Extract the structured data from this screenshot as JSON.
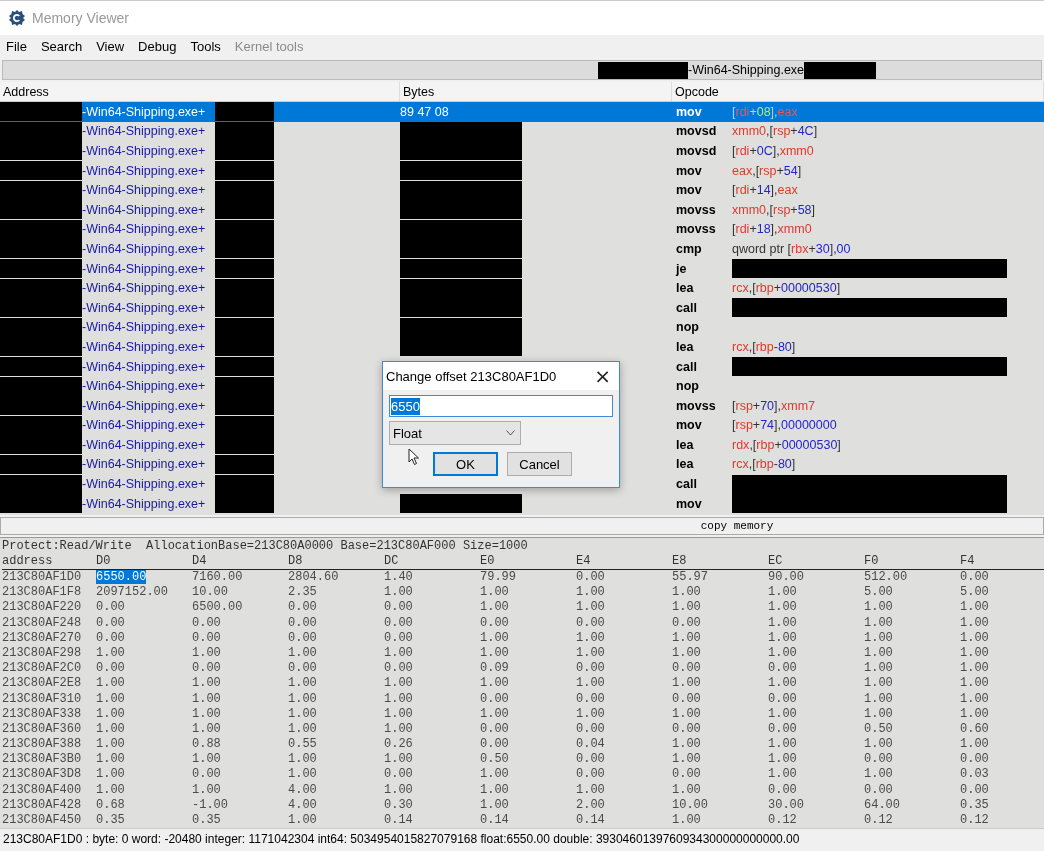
{
  "window": {
    "title": "Memory Viewer"
  },
  "menu": [
    {
      "label": "File",
      "disabled": false
    },
    {
      "label": "Search",
      "disabled": false
    },
    {
      "label": "View",
      "disabled": false
    },
    {
      "label": "Debug",
      "disabled": false
    },
    {
      "label": "Tools",
      "disabled": false
    },
    {
      "label": "Kernel tools",
      "disabled": true
    }
  ],
  "address_bar": {
    "text": "-Win64-Shipping.exe"
  },
  "disassembly": {
    "columns": [
      "Address",
      "Bytes",
      "Opcode"
    ],
    "rows": [
      {
        "module": "-Win64-Shipping.exe+",
        "selected": true,
        "bytes": "89 47 08",
        "bytes_redacted": false,
        "mnemonic": "mov",
        "operand_redacted": false,
        "operands": [
          {
            "kind": "sym",
            "text": "["
          },
          {
            "kind": "reg",
            "text": "rdi"
          },
          {
            "kind": "sym",
            "text": "+"
          },
          {
            "kind": "num",
            "text": "08"
          },
          {
            "kind": "sym",
            "text": "],"
          },
          {
            "kind": "reg",
            "text": "eax"
          }
        ]
      },
      {
        "module": "-Win64-Shipping.exe+",
        "selected": false,
        "bytes_redacted": true,
        "mnemonic": "movsd",
        "operand_redacted": false,
        "operands": [
          {
            "kind": "reg",
            "text": "xmm0"
          },
          {
            "kind": "sym",
            "text": ",["
          },
          {
            "kind": "reg",
            "text": "rsp"
          },
          {
            "kind": "sym",
            "text": "+"
          },
          {
            "kind": "num",
            "text": "4C"
          },
          {
            "kind": "sym",
            "text": "]"
          }
        ]
      },
      {
        "module": "-Win64-Shipping.exe+",
        "selected": false,
        "bytes_redacted": true,
        "mnemonic": "movsd",
        "operand_redacted": false,
        "operands": [
          {
            "kind": "sym",
            "text": "["
          },
          {
            "kind": "reg",
            "text": "rdi"
          },
          {
            "kind": "sym",
            "text": "+"
          },
          {
            "kind": "num",
            "text": "0C"
          },
          {
            "kind": "sym",
            "text": "],"
          },
          {
            "kind": "reg",
            "text": "xmm0"
          }
        ]
      },
      {
        "module": "-Win64-Shipping.exe+",
        "selected": false,
        "bytes_redacted": true,
        "mnemonic": "mov",
        "operand_redacted": false,
        "operands": [
          {
            "kind": "reg",
            "text": "eax"
          },
          {
            "kind": "sym",
            "text": ",["
          },
          {
            "kind": "reg",
            "text": "rsp"
          },
          {
            "kind": "sym",
            "text": "+"
          },
          {
            "kind": "num",
            "text": "54"
          },
          {
            "kind": "sym",
            "text": "]"
          }
        ]
      },
      {
        "module": "-Win64-Shipping.exe+",
        "selected": false,
        "bytes_redacted": true,
        "mnemonic": "mov",
        "operand_redacted": false,
        "operands": [
          {
            "kind": "sym",
            "text": "["
          },
          {
            "kind": "reg",
            "text": "rdi"
          },
          {
            "kind": "sym",
            "text": "+"
          },
          {
            "kind": "num",
            "text": "14"
          },
          {
            "kind": "sym",
            "text": "],"
          },
          {
            "kind": "reg",
            "text": "eax"
          }
        ]
      },
      {
        "module": "-Win64-Shipping.exe+",
        "selected": false,
        "bytes_redacted": true,
        "mnemonic": "movss",
        "operand_redacted": false,
        "operands": [
          {
            "kind": "reg",
            "text": "xmm0"
          },
          {
            "kind": "sym",
            "text": ",["
          },
          {
            "kind": "reg",
            "text": "rsp"
          },
          {
            "kind": "sym",
            "text": "+"
          },
          {
            "kind": "num",
            "text": "58"
          },
          {
            "kind": "sym",
            "text": "]"
          }
        ]
      },
      {
        "module": "-Win64-Shipping.exe+",
        "selected": false,
        "bytes_redacted": true,
        "mnemonic": "movss",
        "operand_redacted": false,
        "operands": [
          {
            "kind": "sym",
            "text": "["
          },
          {
            "kind": "reg",
            "text": "rdi"
          },
          {
            "kind": "sym",
            "text": "+"
          },
          {
            "kind": "num",
            "text": "18"
          },
          {
            "kind": "sym",
            "text": "],"
          },
          {
            "kind": "reg",
            "text": "xmm0"
          }
        ]
      },
      {
        "module": "-Win64-Shipping.exe+",
        "selected": false,
        "bytes_redacted": true,
        "mnemonic": "cmp",
        "operand_redacted": false,
        "operands": [
          {
            "kind": "sym",
            "text": "qword ptr ["
          },
          {
            "kind": "reg",
            "text": "rbx"
          },
          {
            "kind": "sym",
            "text": "+"
          },
          {
            "kind": "num",
            "text": "30"
          },
          {
            "kind": "sym",
            "text": "],"
          },
          {
            "kind": "num",
            "text": "00"
          }
        ]
      },
      {
        "module": "-Win64-Shipping.exe+",
        "selected": false,
        "bytes_redacted": true,
        "mnemonic": "je",
        "operand_redacted": true
      },
      {
        "module": "-Win64-Shipping.exe+",
        "selected": false,
        "bytes_redacted": true,
        "mnemonic": "lea",
        "operand_redacted": false,
        "operands": [
          {
            "kind": "reg",
            "text": "rcx"
          },
          {
            "kind": "sym",
            "text": ",["
          },
          {
            "kind": "reg",
            "text": "rbp"
          },
          {
            "kind": "sym",
            "text": "+"
          },
          {
            "kind": "num",
            "text": "00000530"
          },
          {
            "kind": "sym",
            "text": "]"
          }
        ]
      },
      {
        "module": "-Win64-Shipping.exe+",
        "selected": false,
        "bytes_redacted": true,
        "mnemonic": "call",
        "operand_redacted": true
      },
      {
        "module": "-Win64-Shipping.exe+",
        "selected": false,
        "bytes_redacted": true,
        "mnemonic": "nop",
        "operand_redacted": false
      },
      {
        "module": "-Win64-Shipping.exe+",
        "selected": false,
        "bytes_redacted": true,
        "mnemonic": "lea",
        "operand_redacted": false,
        "operands": [
          {
            "kind": "reg",
            "text": "rcx"
          },
          {
            "kind": "sym",
            "text": ",["
          },
          {
            "kind": "reg",
            "text": "rbp"
          },
          {
            "kind": "sym",
            "text": "-"
          },
          {
            "kind": "num",
            "text": "80"
          },
          {
            "kind": "sym",
            "text": "]"
          }
        ]
      },
      {
        "module": "-Win64-Shipping.exe+",
        "selected": false,
        "bytes_redacted": false,
        "mnemonic": "call",
        "operand_redacted": true
      },
      {
        "module": "-Win64-Shipping.exe+",
        "selected": false,
        "bytes_redacted": false,
        "mnemonic": "nop",
        "operand_redacted": false
      },
      {
        "module": "-Win64-Shipping.exe+",
        "selected": false,
        "bytes_redacted": false,
        "mnemonic": "movss",
        "operand_redacted": false,
        "operands": [
          {
            "kind": "sym",
            "text": "["
          },
          {
            "kind": "reg",
            "text": "rsp"
          },
          {
            "kind": "sym",
            "text": "+"
          },
          {
            "kind": "num",
            "text": "70"
          },
          {
            "kind": "sym",
            "text": "],"
          },
          {
            "kind": "reg",
            "text": "xmm7"
          }
        ]
      },
      {
        "module": "-Win64-Shipping.exe+",
        "selected": false,
        "bytes_redacted": false,
        "mnemonic": "mov",
        "operand_redacted": false,
        "operands": [
          {
            "kind": "sym",
            "text": "["
          },
          {
            "kind": "reg",
            "text": "rsp"
          },
          {
            "kind": "sym",
            "text": "+"
          },
          {
            "kind": "num",
            "text": "74"
          },
          {
            "kind": "sym",
            "text": "],"
          },
          {
            "kind": "num",
            "text": "00000000"
          }
        ]
      },
      {
        "module": "-Win64-Shipping.exe+",
        "selected": false,
        "bytes_redacted": false,
        "mnemonic": "lea",
        "operand_redacted": false,
        "operands": [
          {
            "kind": "reg",
            "text": "rdx"
          },
          {
            "kind": "sym",
            "text": ",["
          },
          {
            "kind": "reg",
            "text": "rbp"
          },
          {
            "kind": "sym",
            "text": "+"
          },
          {
            "kind": "num",
            "text": "00000530"
          },
          {
            "kind": "sym",
            "text": "]"
          }
        ]
      },
      {
        "module": "-Win64-Shipping.exe+",
        "selected": false,
        "bytes_redacted": false,
        "mnemonic": "lea",
        "operand_redacted": false,
        "operands": [
          {
            "kind": "reg",
            "text": "rcx"
          },
          {
            "kind": "sym",
            "text": ",["
          },
          {
            "kind": "reg",
            "text": "rbp"
          },
          {
            "kind": "sym",
            "text": "-"
          },
          {
            "kind": "num",
            "text": "80"
          },
          {
            "kind": "sym",
            "text": "]"
          }
        ]
      },
      {
        "module": "-Win64-Shipping.exe+",
        "selected": false,
        "bytes_redacted": false,
        "mnemonic": "call",
        "operand_redacted": true
      },
      {
        "module": "-Win64-Shipping.exe+",
        "selected": false,
        "bytes_redacted": true,
        "mnemonic": "mov",
        "operand_redacted": true
      }
    ]
  },
  "splitter": {
    "label": "copy memory"
  },
  "hex_view": {
    "info": "Protect:Read/Write  AllocationBase=213C80A0000 Base=213C80AF000 Size=1000",
    "columns": [
      "address",
      "D0",
      "D4",
      "D8",
      "DC",
      "E0",
      "E4",
      "E8",
      "EC",
      "F0",
      "F4"
    ],
    "rows": [
      {
        "address": "213C80AF1D0",
        "values": [
          {
            "text": "6550.00",
            "selected": true
          },
          {
            "text": "7160.00",
            "selected": false
          },
          {
            "text": "2804.60",
            "selected": false
          },
          {
            "text": "1.40",
            "selected": false
          },
          {
            "text": "79.99",
            "selected": false
          },
          {
            "text": "0.00",
            "selected": false
          },
          {
            "text": "55.97",
            "selected": false
          },
          {
            "text": "90.00",
            "selected": false
          },
          {
            "text": "512.00",
            "selected": false
          },
          {
            "text": "0.00",
            "selected": false
          }
        ]
      },
      {
        "address": "213C80AF1F8",
        "values": [
          {
            "text": "2097152.00",
            "selected": false
          },
          {
            "text": "10.00",
            "selected": false
          },
          {
            "text": "2.35",
            "selected": false
          },
          {
            "text": "1.00",
            "selected": false
          },
          {
            "text": "1.00",
            "selected": false
          },
          {
            "text": "1.00",
            "selected": false
          },
          {
            "text": "1.00",
            "selected": false
          },
          {
            "text": "1.00",
            "selected": false
          },
          {
            "text": "5.00",
            "selected": false
          },
          {
            "text": "5.00",
            "selected": false
          }
        ]
      },
      {
        "address": "213C80AF220",
        "values": [
          {
            "text": "0.00",
            "selected": false
          },
          {
            "text": "6500.00",
            "selected": false
          },
          {
            "text": "0.00",
            "selected": false
          },
          {
            "text": "0.00",
            "selected": false
          },
          {
            "text": "1.00",
            "selected": false
          },
          {
            "text": "1.00",
            "selected": false
          },
          {
            "text": "1.00",
            "selected": false
          },
          {
            "text": "1.00",
            "selected": false
          },
          {
            "text": "1.00",
            "selected": false
          },
          {
            "text": "1.00",
            "selected": false
          }
        ]
      },
      {
        "address": "213C80AF248",
        "values": [
          {
            "text": "0.00",
            "selected": false
          },
          {
            "text": "0.00",
            "selected": false
          },
          {
            "text": "0.00",
            "selected": false
          },
          {
            "text": "0.00",
            "selected": false
          },
          {
            "text": "0.00",
            "selected": false
          },
          {
            "text": "0.00",
            "selected": false
          },
          {
            "text": "0.00",
            "selected": false
          },
          {
            "text": "1.00",
            "selected": false
          },
          {
            "text": "1.00",
            "selected": false
          },
          {
            "text": "1.00",
            "selected": false
          }
        ]
      },
      {
        "address": "213C80AF270",
        "values": [
          {
            "text": "0.00",
            "selected": false
          },
          {
            "text": "0.00",
            "selected": false
          },
          {
            "text": "0.00",
            "selected": false
          },
          {
            "text": "0.00",
            "selected": false
          },
          {
            "text": "1.00",
            "selected": false
          },
          {
            "text": "1.00",
            "selected": false
          },
          {
            "text": "1.00",
            "selected": false
          },
          {
            "text": "1.00",
            "selected": false
          },
          {
            "text": "1.00",
            "selected": false
          },
          {
            "text": "1.00",
            "selected": false
          }
        ]
      },
      {
        "address": "213C80AF298",
        "values": [
          {
            "text": "1.00",
            "selected": false
          },
          {
            "text": "1.00",
            "selected": false
          },
          {
            "text": "1.00",
            "selected": false
          },
          {
            "text": "1.00",
            "selected": false
          },
          {
            "text": "1.00",
            "selected": false
          },
          {
            "text": "1.00",
            "selected": false
          },
          {
            "text": "1.00",
            "selected": false
          },
          {
            "text": "1.00",
            "selected": false
          },
          {
            "text": "1.00",
            "selected": false
          },
          {
            "text": "1.00",
            "selected": false
          }
        ]
      },
      {
        "address": "213C80AF2C0",
        "values": [
          {
            "text": "0.00",
            "selected": false
          },
          {
            "text": "0.00",
            "selected": false
          },
          {
            "text": "0.00",
            "selected": false
          },
          {
            "text": "0.00",
            "selected": false
          },
          {
            "text": "0.09",
            "selected": false
          },
          {
            "text": "0.00",
            "selected": false
          },
          {
            "text": "0.00",
            "selected": false
          },
          {
            "text": "0.00",
            "selected": false
          },
          {
            "text": "1.00",
            "selected": false
          },
          {
            "text": "1.00",
            "selected": false
          }
        ]
      },
      {
        "address": "213C80AF2E8",
        "values": [
          {
            "text": "1.00",
            "selected": false
          },
          {
            "text": "1.00",
            "selected": false
          },
          {
            "text": "1.00",
            "selected": false
          },
          {
            "text": "1.00",
            "selected": false
          },
          {
            "text": "1.00",
            "selected": false
          },
          {
            "text": "1.00",
            "selected": false
          },
          {
            "text": "1.00",
            "selected": false
          },
          {
            "text": "1.00",
            "selected": false
          },
          {
            "text": "1.00",
            "selected": false
          },
          {
            "text": "1.00",
            "selected": false
          }
        ]
      },
      {
        "address": "213C80AF310",
        "values": [
          {
            "text": "1.00",
            "selected": false
          },
          {
            "text": "1.00",
            "selected": false
          },
          {
            "text": "1.00",
            "selected": false
          },
          {
            "text": "1.00",
            "selected": false
          },
          {
            "text": "0.00",
            "selected": false
          },
          {
            "text": "0.00",
            "selected": false
          },
          {
            "text": "0.00",
            "selected": false
          },
          {
            "text": "0.00",
            "selected": false
          },
          {
            "text": "1.00",
            "selected": false
          },
          {
            "text": "1.00",
            "selected": false
          }
        ]
      },
      {
        "address": "213C80AF338",
        "values": [
          {
            "text": "1.00",
            "selected": false
          },
          {
            "text": "1.00",
            "selected": false
          },
          {
            "text": "1.00",
            "selected": false
          },
          {
            "text": "1.00",
            "selected": false
          },
          {
            "text": "1.00",
            "selected": false
          },
          {
            "text": "1.00",
            "selected": false
          },
          {
            "text": "1.00",
            "selected": false
          },
          {
            "text": "1.00",
            "selected": false
          },
          {
            "text": "1.00",
            "selected": false
          },
          {
            "text": "1.00",
            "selected": false
          }
        ]
      },
      {
        "address": "213C80AF360",
        "values": [
          {
            "text": "1.00",
            "selected": false
          },
          {
            "text": "1.00",
            "selected": false
          },
          {
            "text": "1.00",
            "selected": false
          },
          {
            "text": "1.00",
            "selected": false
          },
          {
            "text": "0.00",
            "selected": false
          },
          {
            "text": "0.00",
            "selected": false
          },
          {
            "text": "0.00",
            "selected": false
          },
          {
            "text": "0.00",
            "selected": false
          },
          {
            "text": "0.50",
            "selected": false
          },
          {
            "text": "0.60",
            "selected": false
          }
        ]
      },
      {
        "address": "213C80AF388",
        "values": [
          {
            "text": "1.00",
            "selected": false
          },
          {
            "text": "0.88",
            "selected": false
          },
          {
            "text": "0.55",
            "selected": false
          },
          {
            "text": "0.26",
            "selected": false
          },
          {
            "text": "0.00",
            "selected": false
          },
          {
            "text": "0.04",
            "selected": false
          },
          {
            "text": "1.00",
            "selected": false
          },
          {
            "text": "1.00",
            "selected": false
          },
          {
            "text": "1.00",
            "selected": false
          },
          {
            "text": "1.00",
            "selected": false
          }
        ]
      },
      {
        "address": "213C80AF3B0",
        "values": [
          {
            "text": "1.00",
            "selected": false
          },
          {
            "text": "1.00",
            "selected": false
          },
          {
            "text": "1.00",
            "selected": false
          },
          {
            "text": "1.00",
            "selected": false
          },
          {
            "text": "0.50",
            "selected": false
          },
          {
            "text": "0.00",
            "selected": false
          },
          {
            "text": "1.00",
            "selected": false
          },
          {
            "text": "1.00",
            "selected": false
          },
          {
            "text": "0.00",
            "selected": false
          },
          {
            "text": "0.00",
            "selected": false
          }
        ]
      },
      {
        "address": "213C80AF3D8",
        "values": [
          {
            "text": "1.00",
            "selected": false
          },
          {
            "text": "0.00",
            "selected": false
          },
          {
            "text": "1.00",
            "selected": false
          },
          {
            "text": "0.00",
            "selected": false
          },
          {
            "text": "1.00",
            "selected": false
          },
          {
            "text": "0.00",
            "selected": false
          },
          {
            "text": "0.00",
            "selected": false
          },
          {
            "text": "1.00",
            "selected": false
          },
          {
            "text": "1.00",
            "selected": false
          },
          {
            "text": "0.03",
            "selected": false
          }
        ]
      },
      {
        "address": "213C80AF400",
        "values": [
          {
            "text": "1.00",
            "selected": false
          },
          {
            "text": "1.00",
            "selected": false
          },
          {
            "text": "4.00",
            "selected": false
          },
          {
            "text": "1.00",
            "selected": false
          },
          {
            "text": "1.00",
            "selected": false
          },
          {
            "text": "1.00",
            "selected": false
          },
          {
            "text": "1.00",
            "selected": false
          },
          {
            "text": "0.00",
            "selected": false
          },
          {
            "text": "0.00",
            "selected": false
          },
          {
            "text": "0.00",
            "selected": false
          }
        ]
      },
      {
        "address": "213C80AF428",
        "values": [
          {
            "text": "0.68",
            "selected": false
          },
          {
            "text": "-1.00",
            "selected": false
          },
          {
            "text": "4.00",
            "selected": false
          },
          {
            "text": "0.30",
            "selected": false
          },
          {
            "text": "1.00",
            "selected": false
          },
          {
            "text": "2.00",
            "selected": false
          },
          {
            "text": "10.00",
            "selected": false
          },
          {
            "text": "30.00",
            "selected": false
          },
          {
            "text": "64.00",
            "selected": false
          },
          {
            "text": "0.35",
            "selected": false
          }
        ]
      },
      {
        "address": "213C80AF450",
        "values": [
          {
            "text": "0.35",
            "selected": false
          },
          {
            "text": "0.35",
            "selected": false
          },
          {
            "text": "1.00",
            "selected": false
          },
          {
            "text": "0.14",
            "selected": false
          },
          {
            "text": "0.14",
            "selected": false
          },
          {
            "text": "0.14",
            "selected": false
          },
          {
            "text": "1.00",
            "selected": false
          },
          {
            "text": "0.12",
            "selected": false
          },
          {
            "text": "0.12",
            "selected": false
          },
          {
            "text": "0.12",
            "selected": false
          }
        ]
      }
    ]
  },
  "status_bar": {
    "text": "213C80AF1D0 : byte: 0 word: -20480 integer: 1171042304 int64: 5034954015827079168 float:6550.00 double: 3930460139760934300000000000.00"
  },
  "dialog": {
    "title": "Change offset 213C80AF1D0",
    "close": "×",
    "value": "6550",
    "value_selected": true,
    "type": "Float",
    "buttons": [
      {
        "label": "OK",
        "default": true
      },
      {
        "label": "Cancel",
        "default": false
      }
    ]
  }
}
